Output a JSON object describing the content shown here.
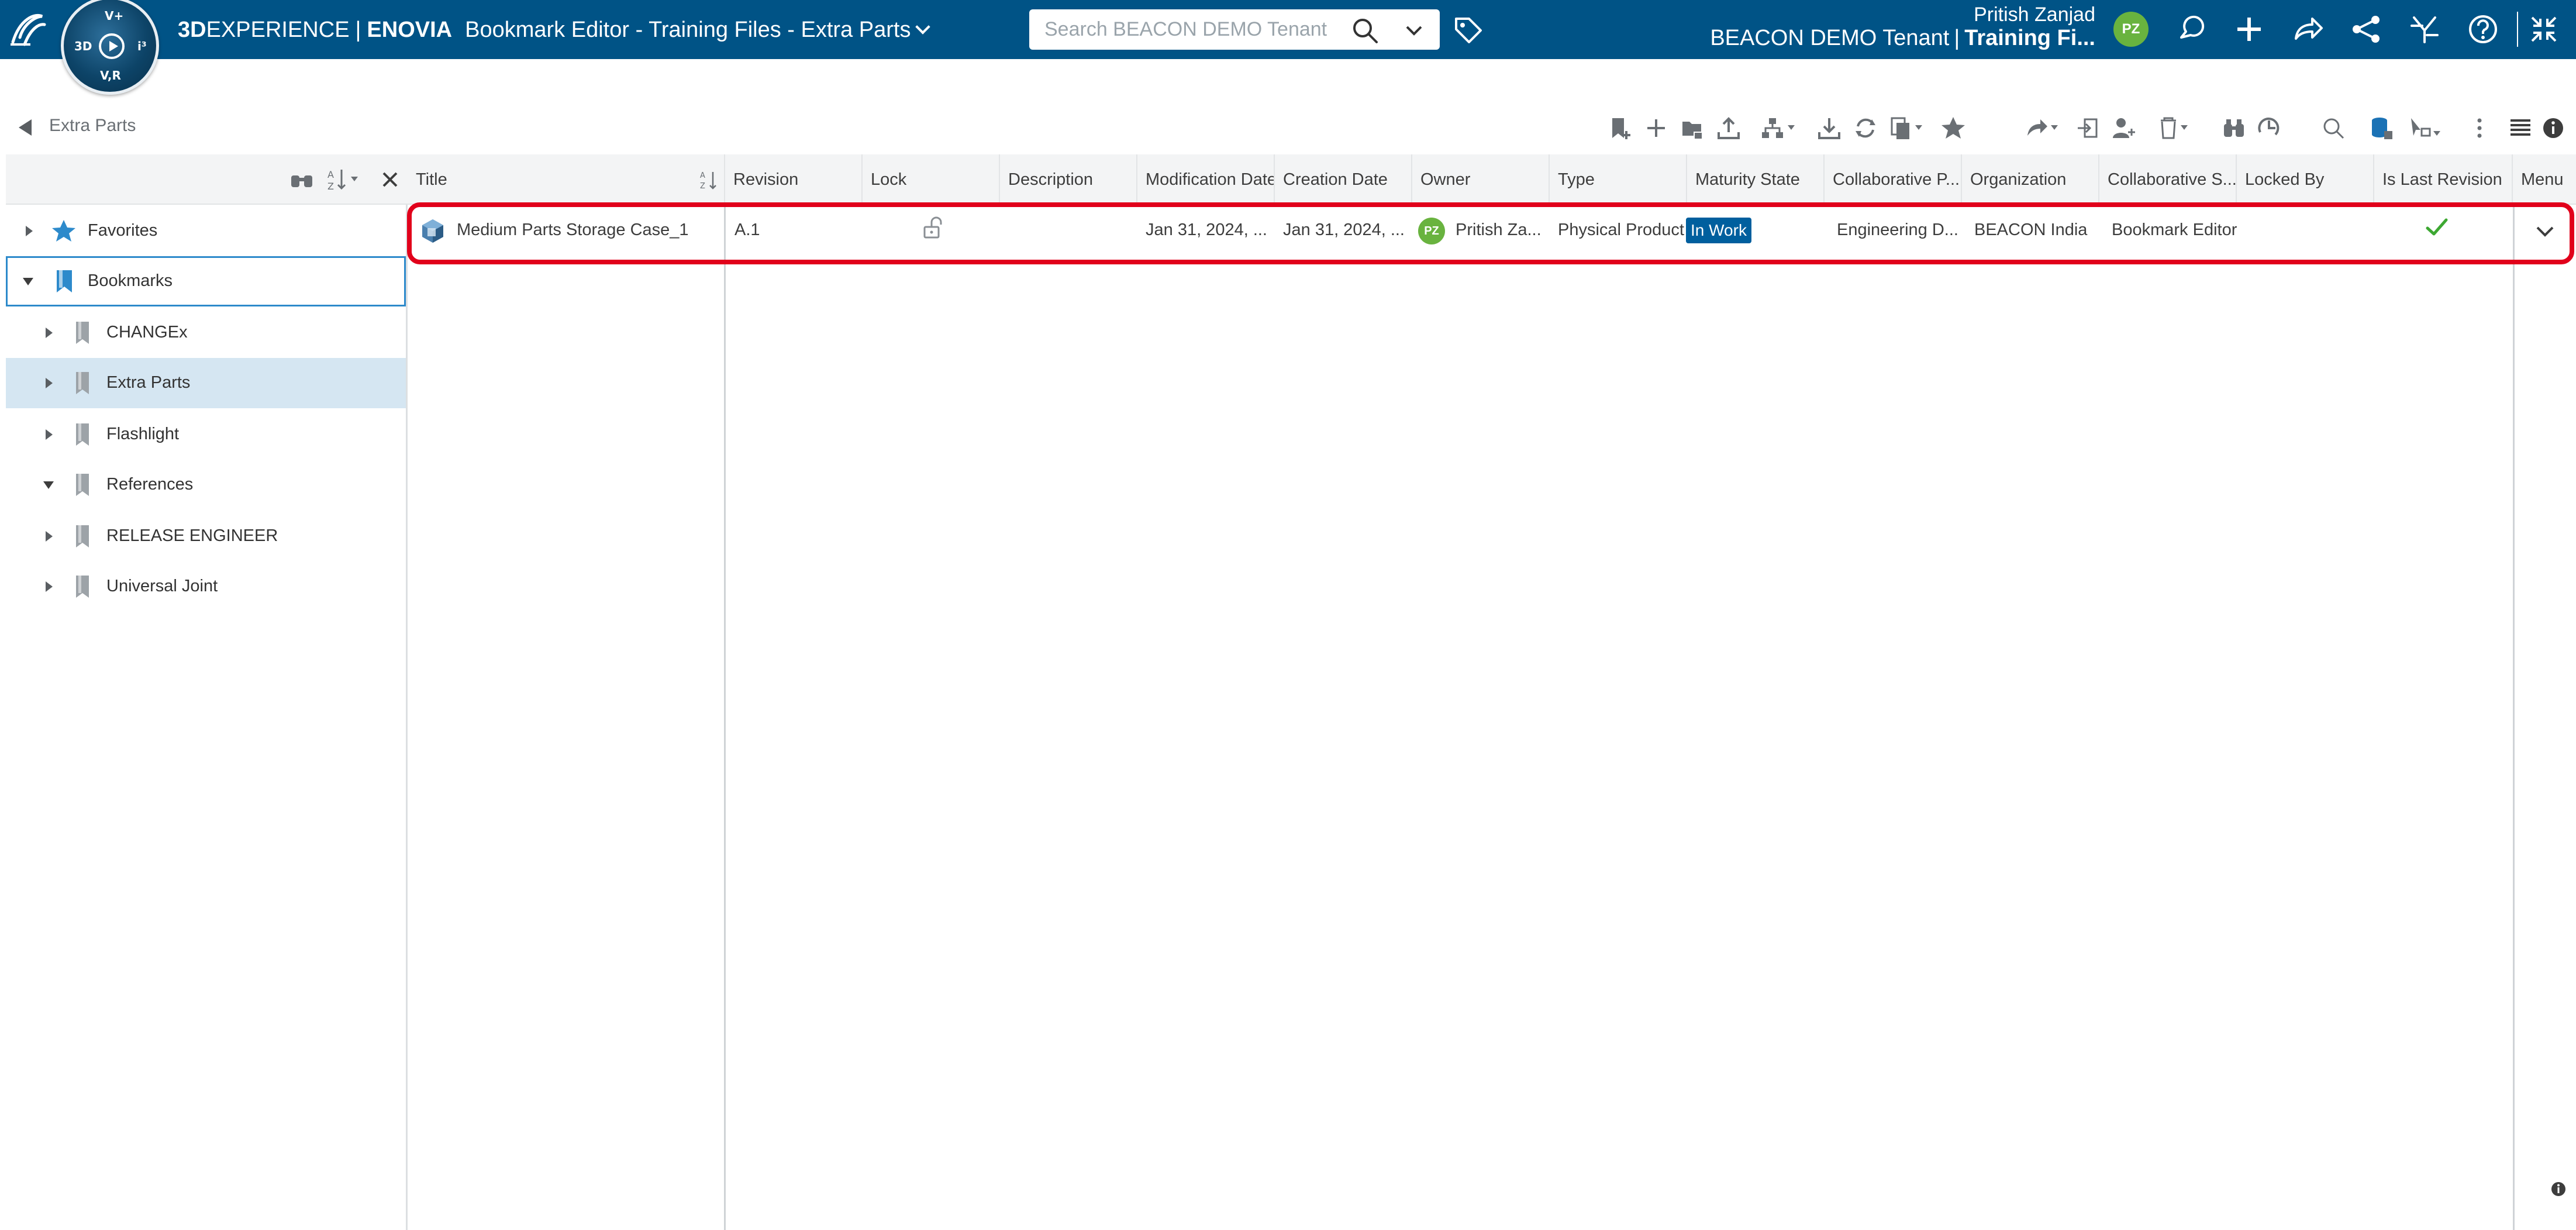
{
  "header": {
    "brand_3d": "3D",
    "brand_experience": "EXPERIENCE",
    "brand_separator": "|",
    "brand_app": "ENOVIA",
    "title": "Bookmark Editor - Training Files - Extra Parts",
    "compass": {
      "top": "V+",
      "left": "3D",
      "right": "i³",
      "bottom": "V,R"
    },
    "search_placeholder": "Search BEACON DEMO Tenant",
    "user_name": "Pritish Zanjad",
    "tenant": "BEACON DEMO Tenant",
    "tenant_separator": "|",
    "collab_space": "Training Fi...",
    "avatar_initials": "PZ",
    "colors": {
      "topbar": "#005386",
      "avatar": "#69b33f",
      "accent": "#005f9e",
      "highlight": "#e1001b"
    }
  },
  "breadcrumb": {
    "label": "Extra Parts"
  },
  "tree": {
    "nodes": [
      {
        "label": "Favorites",
        "expanded": false
      },
      {
        "label": "Bookmarks",
        "expanded": true
      },
      {
        "label": "CHANGEx",
        "expanded": false
      },
      {
        "label": "Extra Parts",
        "expanded": false
      },
      {
        "label": "Flashlight",
        "expanded": false
      },
      {
        "label": "References",
        "expanded": true
      },
      {
        "label": "RELEASE ENGINEER",
        "expanded": false
      },
      {
        "label": "Universal Joint",
        "expanded": false
      }
    ]
  },
  "grid": {
    "columns": [
      "Title",
      "Revision",
      "Lock",
      "Description",
      "Modification Date",
      "Creation Date",
      "Owner",
      "Type",
      "Maturity State",
      "Collaborative P...",
      "Organization",
      "Collaborative S...",
      "Locked By",
      "Is Last Revision",
      "Menu"
    ],
    "rows": [
      {
        "title": "Medium Parts Storage Case_1",
        "revision": "A.1",
        "description": "",
        "modification_date": "Jan 31, 2024, ...",
        "creation_date": "Jan 31, 2024, ...",
        "owner_initials": "PZ",
        "owner": "Pritish Za...",
        "type": "Physical Product",
        "maturity_state": "In Work",
        "collaborative_policy": "Engineering D...",
        "organization": "BEACON India",
        "collaborative_space": "Bookmark Editor",
        "locked_by": "",
        "is_last_revision": true
      }
    ]
  }
}
